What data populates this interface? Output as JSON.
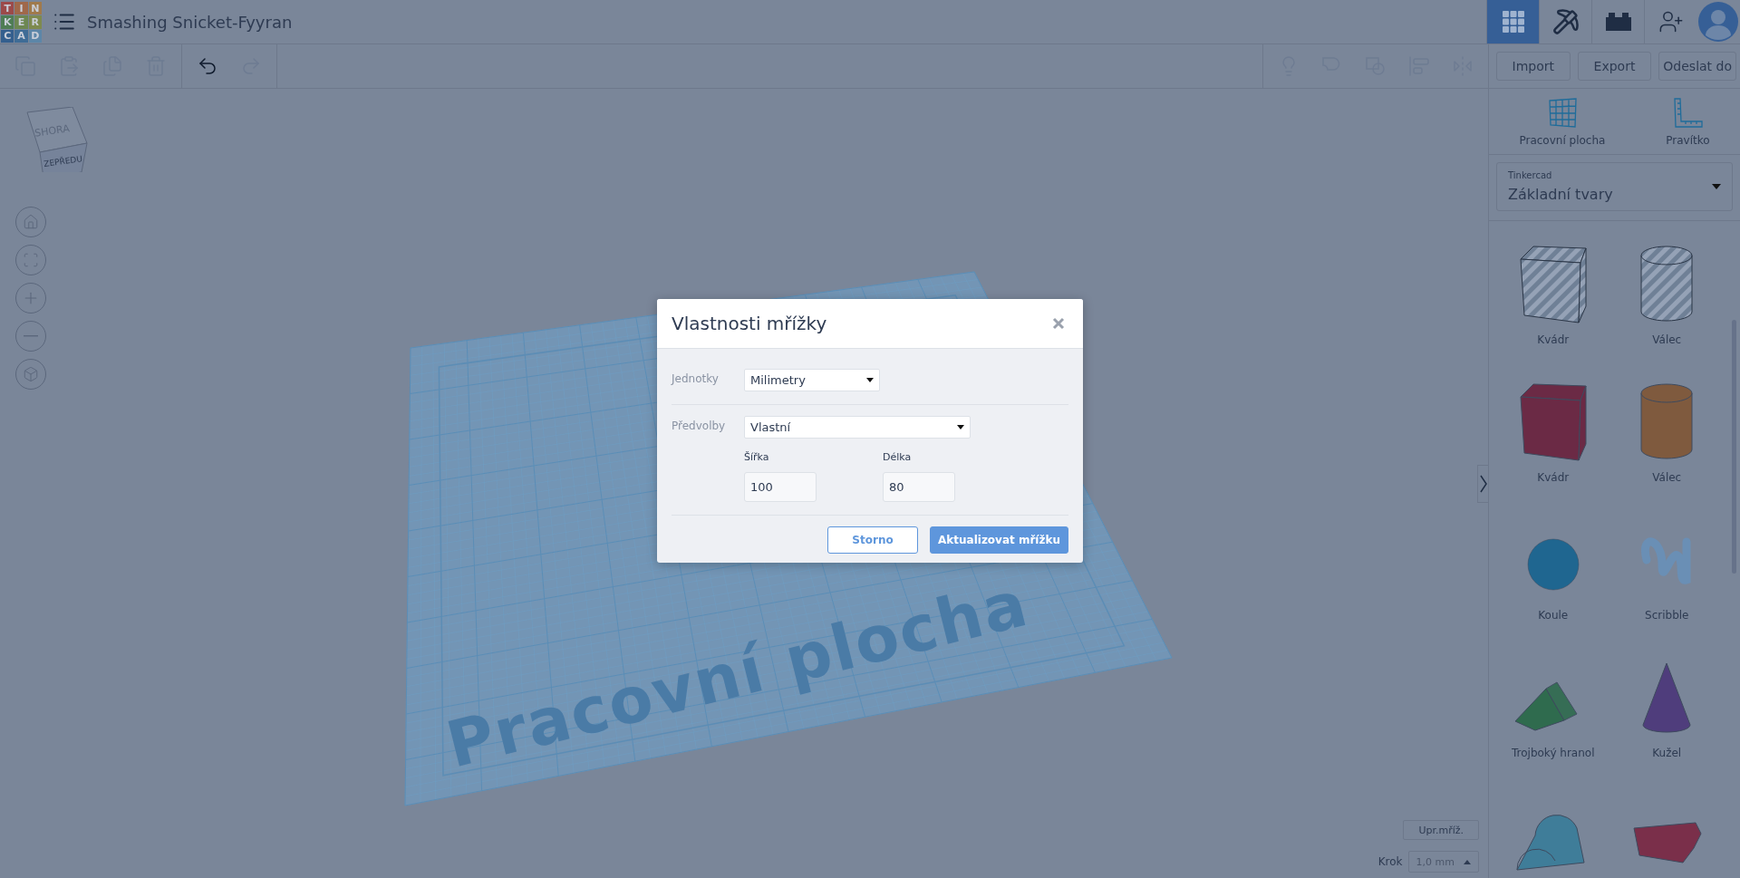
{
  "top_bar": {
    "logo": [
      {
        "letter": "T",
        "color": "#9c4a4a"
      },
      {
        "letter": "I",
        "color": "#a0684a"
      },
      {
        "letter": "N",
        "color": "#a07a4c"
      },
      {
        "letter": "K",
        "color": "#4f7d55"
      },
      {
        "letter": "E",
        "color": "#6d8752"
      },
      {
        "letter": "R",
        "color": "#7e8a4f"
      },
      {
        "letter": "C",
        "color": "#345f8e"
      },
      {
        "letter": "A",
        "color": "#3f6c96"
      },
      {
        "letter": "D",
        "color": "#5c86a8"
      }
    ],
    "project_title": "Smashing Snicket-Fyyran",
    "nav": [
      {
        "kind": "grid",
        "selected": true
      },
      {
        "kind": "pickaxe",
        "selected": false
      },
      {
        "kind": "brick",
        "selected": false
      }
    ]
  },
  "toolbar": {
    "edit_tools": [
      {
        "kind": "copy",
        "disabled": true
      },
      {
        "kind": "paste",
        "disabled": true
      },
      {
        "kind": "duplicate",
        "disabled": true
      },
      {
        "kind": "delete",
        "disabled": true
      }
    ],
    "history_tools": [
      {
        "kind": "undo",
        "disabled": false
      },
      {
        "kind": "redo",
        "disabled": true
      }
    ],
    "view_tools": [
      {
        "kind": "light",
        "disabled": true
      },
      {
        "kind": "group",
        "disabled": true
      },
      {
        "kind": "ungroup",
        "disabled": true
      },
      {
        "kind": "align",
        "disabled": true
      },
      {
        "kind": "mirror",
        "disabled": true
      }
    ],
    "buttons": [
      "Import",
      "Export",
      "Odeslat do"
    ]
  },
  "view_cube": {
    "top": "SHORA",
    "front": "ZEPŘEDU"
  },
  "nav_controls": [
    {
      "kind": "home"
    },
    {
      "kind": "fit"
    },
    {
      "kind": "zoom_in"
    },
    {
      "kind": "zoom_out"
    },
    {
      "kind": "perspective"
    }
  ],
  "workplane": {
    "label": "Pracovní plocha"
  },
  "grid_controls": {
    "edit_button": "Upr.mříž.",
    "step_label": "Krok",
    "step_value": "1,0 mm"
  },
  "side_panel": {
    "tools": [
      {
        "kind": "workplane",
        "label": "Pracovní plocha"
      },
      {
        "kind": "ruler",
        "label": "Pravítko"
      }
    ],
    "library": {
      "provider": "Tinkercad",
      "category": "Základní tvary"
    },
    "shapes": [
      {
        "kind": "box",
        "hole": true,
        "color": "#6f8096",
        "label": "Kvádr"
      },
      {
        "kind": "cylinder",
        "hole": true,
        "color": "#6f8096",
        "label": "Válec"
      },
      {
        "kind": "box",
        "hole": false,
        "color": "#6b2a45",
        "label": "Kvádr"
      },
      {
        "kind": "cylinder",
        "hole": false,
        "color": "#7f5a3e",
        "label": "Válec"
      },
      {
        "kind": "sphere",
        "color": "#1f6690",
        "label": "Koule"
      },
      {
        "kind": "scribble",
        "color": "#6a8fb5",
        "label": "Scribble"
      },
      {
        "kind": "prism",
        "color": "#2f6b4e",
        "label": "Trojboký hranol"
      },
      {
        "kind": "cone",
        "color": "#4f3d7c",
        "label": "Kužel"
      },
      {
        "kind": "roof",
        "color": "#3f7d99"
      },
      {
        "kind": "text",
        "color": "#7a2f4a"
      }
    ]
  },
  "dialog": {
    "title": "Vlastnosti mřížky",
    "units": {
      "label": "Jednotky",
      "value": "Milimetry"
    },
    "presets": {
      "label": "Předvolby",
      "value": "Vlastní"
    },
    "width": {
      "label": "Šířka",
      "value": "100"
    },
    "length": {
      "label": "Délka",
      "value": "80"
    },
    "buttons": [
      {
        "kind": "secondary",
        "label": "Storno"
      },
      {
        "kind": "primary",
        "label": "Aktualizovat mřížku"
      }
    ]
  }
}
